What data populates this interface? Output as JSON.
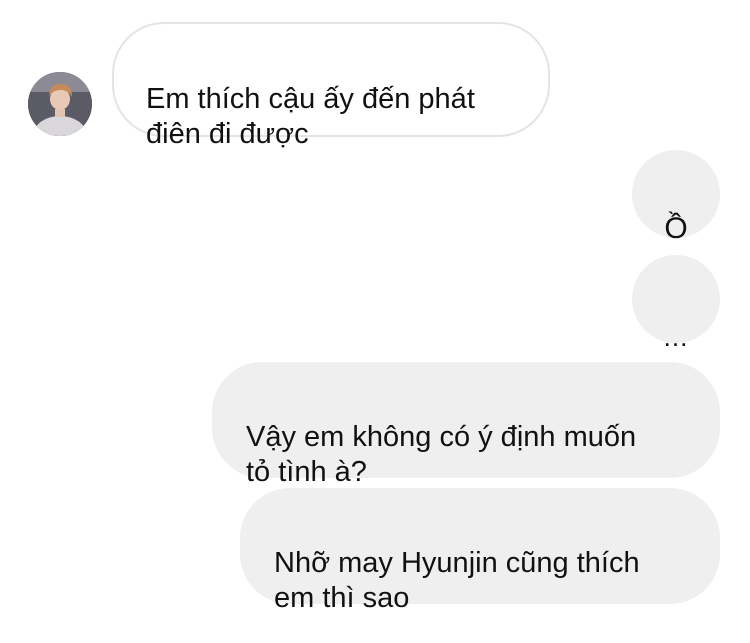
{
  "conversation": {
    "contact": {
      "avatar_icon": "profile-photo"
    },
    "messages": [
      {
        "direction": "incoming",
        "text": "Em thích cậu ấy đến phát\nđiên đi được"
      },
      {
        "direction": "outgoing",
        "text": "Ồ"
      },
      {
        "direction": "outgoing",
        "text": "..."
      },
      {
        "direction": "outgoing",
        "text": "Vậy em không có ý định muốn\ntỏ tình à?"
      },
      {
        "direction": "outgoing",
        "text": "Nhỡ may Hyunjin cũng thích\nem thì sao"
      }
    ]
  },
  "colors": {
    "background": "#ffffff",
    "incoming_bubble": "#ffffff",
    "incoming_border": "#e4e4e8",
    "outgoing_bubble": "#efefef",
    "text": "#111111"
  }
}
